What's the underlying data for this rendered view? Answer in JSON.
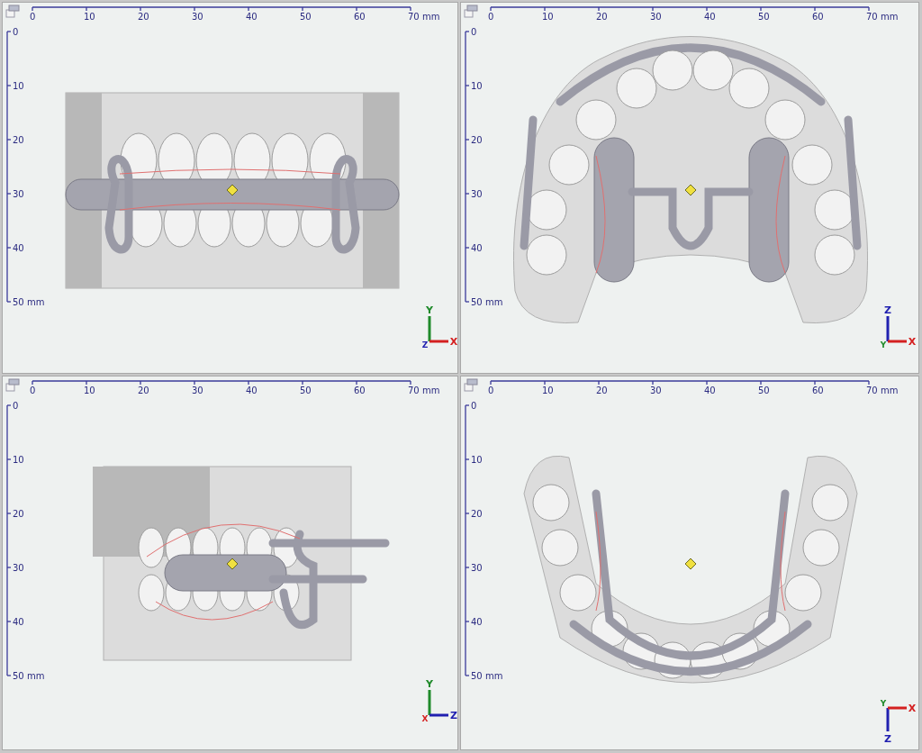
{
  "views": [
    {
      "kind": "front",
      "x_ticks": [
        "0",
        "10",
        "20",
        "30",
        "40",
        "50",
        "60",
        "70 mm"
      ],
      "y_ticks": [
        "0",
        "10",
        "20",
        "30",
        "40",
        "50 mm"
      ],
      "axes": [
        {
          "kind": "up",
          "label": "Y",
          "color": "#1f8a2a"
        },
        {
          "kind": "right",
          "label": "X",
          "color": "#d42020"
        }
      ],
      "origin_label": {
        "label": "Z",
        "color": "#2020b0"
      }
    },
    {
      "kind": "occlusal-upper",
      "x_ticks": [
        "0",
        "10",
        "20",
        "30",
        "40",
        "50",
        "60",
        "70 mm"
      ],
      "y_ticks": [
        "0",
        "10",
        "20",
        "30",
        "40",
        "50 mm"
      ],
      "axes": [
        {
          "kind": "up",
          "label": "Z",
          "color": "#2020b0"
        },
        {
          "kind": "right",
          "label": "X",
          "color": "#d42020"
        }
      ],
      "origin_label": {
        "label": "Y",
        "color": "#1f8a2a"
      }
    },
    {
      "kind": "side",
      "x_ticks": [
        "0",
        "10",
        "20",
        "30",
        "40",
        "50",
        "60",
        "70 mm"
      ],
      "y_ticks": [
        "0",
        "10",
        "20",
        "30",
        "40",
        "50 mm"
      ],
      "axes": [
        {
          "kind": "up",
          "label": "Y",
          "color": "#1f8a2a"
        },
        {
          "kind": "right",
          "label": "Z",
          "color": "#2020b0"
        }
      ],
      "origin_label": {
        "label": "X",
        "color": "#d42020"
      }
    },
    {
      "kind": "occlusal-lower",
      "x_ticks": [
        "0",
        "10",
        "20",
        "30",
        "40",
        "50",
        "60",
        "70 mm"
      ],
      "y_ticks": [
        "0",
        "10",
        "20",
        "30",
        "40",
        "50 mm"
      ],
      "axes": [
        {
          "kind": "down",
          "label": "Z",
          "color": "#2020b0"
        },
        {
          "kind": "right",
          "label": "X",
          "color": "#d42020"
        }
      ],
      "origin_label": {
        "label": "Y",
        "color": "#1f8a2a"
      }
    }
  ]
}
